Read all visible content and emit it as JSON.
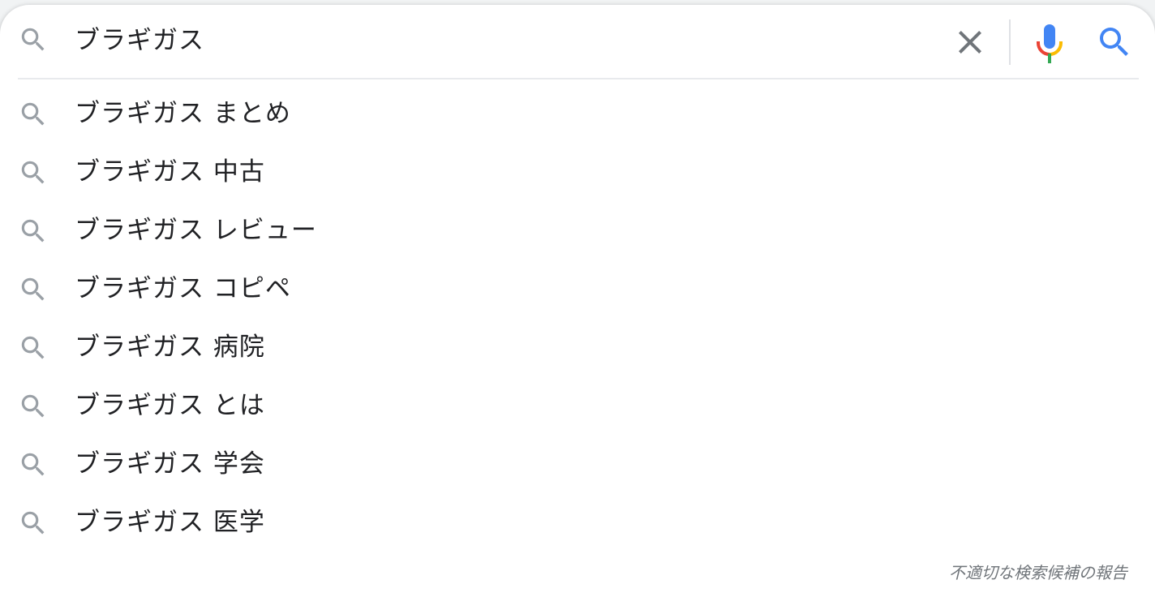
{
  "search": {
    "query": "ブラギガス",
    "clear_icon": "close-icon",
    "mic_icon": "microphone-icon",
    "submit_icon": "search-icon",
    "colors": {
      "gray_icon": "#9aa0a6",
      "clear": "#70757a",
      "blue": "#4285f4",
      "red": "#ea4335",
      "yellow": "#fbbc04",
      "green": "#34a853",
      "text": "#202124"
    }
  },
  "suggestions": [
    {
      "text": "ブラギガス まとめ",
      "icon": "search-icon"
    },
    {
      "text": "ブラギガス 中古",
      "icon": "search-icon"
    },
    {
      "text": "ブラギガス レビュー",
      "icon": "search-icon"
    },
    {
      "text": "ブラギガス コピペ",
      "icon": "search-icon"
    },
    {
      "text": "ブラギガス 病院",
      "icon": "search-icon"
    },
    {
      "text": "ブラギガス とは",
      "icon": "search-icon"
    },
    {
      "text": "ブラギガス 学会",
      "icon": "search-icon"
    },
    {
      "text": "ブラギガス 医学",
      "icon": "search-icon"
    }
  ],
  "footer": {
    "report_label": "不適切な検索候補の報告"
  }
}
